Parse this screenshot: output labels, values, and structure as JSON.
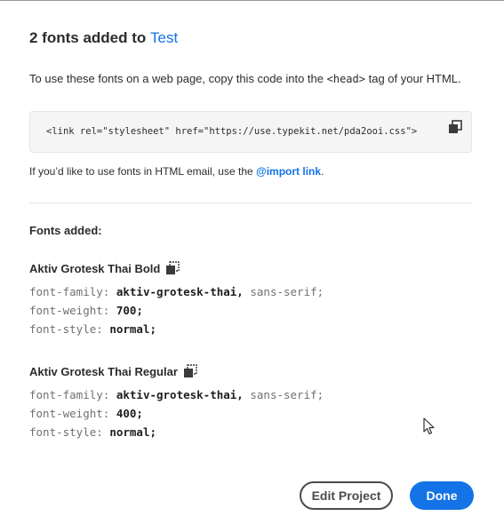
{
  "dialog": {
    "title_prefix": "2 fonts added to ",
    "kit_name": "Test"
  },
  "intro": {
    "before": "To use these fonts on a web page, copy this code into the ",
    "tag": "<head>",
    "after": " tag of your HTML."
  },
  "embed_code": "<link rel=\"stylesheet\" href=\"https://use.typekit.net/pda2ooi.css\">",
  "email_note": {
    "text": "If you’d like to use fonts in HTML email, use the ",
    "link_label": "@import link",
    "suffix": "."
  },
  "fonts_heading": "Fonts added:",
  "fonts": [
    {
      "name": "Aktiv Grotesk Thai Bold",
      "family_prop": "font-family:",
      "family_value": "aktiv-grotesk-thai,",
      "family_fallback": "sans-serif;",
      "weight_prop": "font-weight:",
      "weight_value": "700;",
      "style_prop": "font-style:",
      "style_value": "normal;"
    },
    {
      "name": "Aktiv Grotesk Thai Regular",
      "family_prop": "font-family:",
      "family_value": "aktiv-grotesk-thai,",
      "family_fallback": "sans-serif;",
      "weight_prop": "font-weight:",
      "weight_value": "400;",
      "style_prop": "font-style:",
      "style_value": "normal;"
    }
  ],
  "buttons": {
    "edit_project": "Edit Project",
    "done": "Done"
  },
  "icons": {
    "copy": "copy-icon",
    "cursor": "mouse-pointer-icon"
  },
  "colors": {
    "accent": "#1473e6",
    "text": "#2c2c2c"
  }
}
